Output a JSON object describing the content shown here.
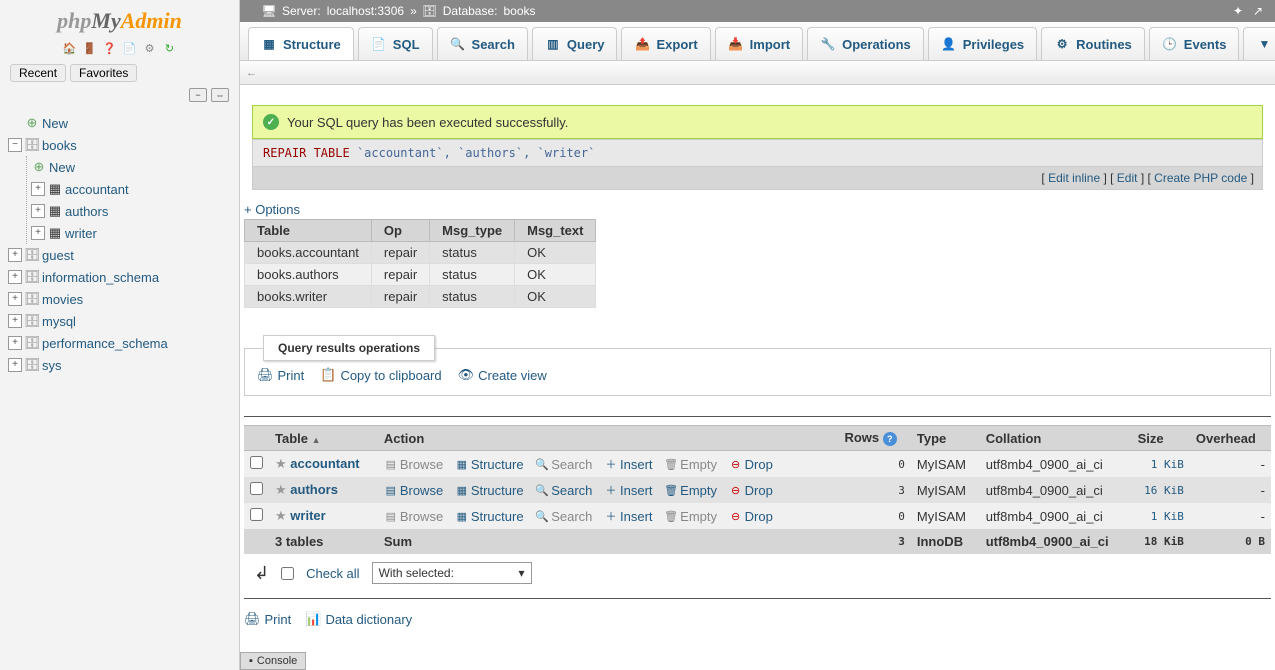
{
  "logo_parts": {
    "php": "php",
    "my": "My",
    "admin": "Admin"
  },
  "history": {
    "recent": "Recent",
    "favorites": "Favorites"
  },
  "tree": {
    "new": "New",
    "dbs": [
      "books",
      "guest",
      "information_schema",
      "movies",
      "mysql",
      "performance_schema",
      "sys"
    ],
    "books_children": [
      "New",
      "accountant",
      "authors",
      "writer"
    ]
  },
  "breadcrumb": {
    "server_label": "Server:",
    "server_val": "localhost:3306",
    "sep": "»",
    "db_label": "Database:",
    "db_val": "books"
  },
  "tabs": [
    "Structure",
    "SQL",
    "Search",
    "Query",
    "Export",
    "Import",
    "Operations",
    "Privileges",
    "Routines",
    "Events",
    "More"
  ],
  "success_msg": "Your SQL query has been executed successfully.",
  "sql_query": {
    "kw": "REPAIR TABLE",
    "tables": "`accountant`, `authors`, `writer`"
  },
  "sql_actions": {
    "edit_inline": "Edit inline",
    "edit": "Edit",
    "create_php": "Create PHP code"
  },
  "options_link": "+ Options",
  "result_headers": [
    "Table",
    "Op",
    "Msg_type",
    "Msg_text"
  ],
  "result_rows": [
    {
      "table": "books.accountant",
      "op": "repair",
      "msg_type": "status",
      "msg_text": "OK"
    },
    {
      "table": "books.authors",
      "op": "repair",
      "msg_type": "status",
      "msg_text": "OK"
    },
    {
      "table": "books.writer",
      "op": "repair",
      "msg_type": "status",
      "msg_text": "OK"
    }
  ],
  "qops": {
    "legend": "Query results operations",
    "print": "Print",
    "copy": "Copy to clipboard",
    "create_view": "Create view"
  },
  "tlist": {
    "headers": {
      "table": "Table",
      "action": "Action",
      "rows": "Rows",
      "type": "Type",
      "collation": "Collation",
      "size": "Size",
      "overhead": "Overhead"
    },
    "actions": {
      "browse": "Browse",
      "structure": "Structure",
      "search": "Search",
      "insert": "Insert",
      "empty": "Empty",
      "drop": "Drop"
    },
    "rows": [
      {
        "name": "accountant",
        "rows": "0",
        "type": "MyISAM",
        "collation": "utf8mb4_0900_ai_ci",
        "size": "1 KiB",
        "overhead": "-"
      },
      {
        "name": "authors",
        "rows": "3",
        "type": "MyISAM",
        "collation": "utf8mb4_0900_ai_ci",
        "size": "16 KiB",
        "overhead": "-"
      },
      {
        "name": "writer",
        "rows": "0",
        "type": "MyISAM",
        "collation": "utf8mb4_0900_ai_ci",
        "size": "1 KiB",
        "overhead": "-"
      }
    ],
    "sum": {
      "label": "3 tables",
      "sum": "Sum",
      "rows": "3",
      "type": "InnoDB",
      "collation": "utf8mb4_0900_ai_ci",
      "size": "18 KiB",
      "overhead": "0 B"
    }
  },
  "checkall": {
    "label": "Check all",
    "selected": "With selected:"
  },
  "bottom": {
    "print": "Print",
    "datadict": "Data dictionary"
  },
  "console": "Console"
}
